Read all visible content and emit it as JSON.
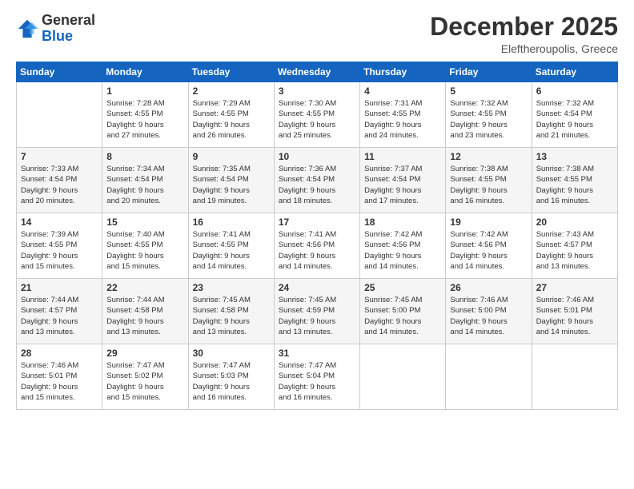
{
  "logo": {
    "general": "General",
    "blue": "Blue"
  },
  "header": {
    "month": "December 2025",
    "location": "Eleftheroupolis, Greece"
  },
  "weekdays": [
    "Sunday",
    "Monday",
    "Tuesday",
    "Wednesday",
    "Thursday",
    "Friday",
    "Saturday"
  ],
  "weeks": [
    [
      {
        "day": "",
        "info": ""
      },
      {
        "day": "1",
        "info": "Sunrise: 7:28 AM\nSunset: 4:55 PM\nDaylight: 9 hours\nand 27 minutes."
      },
      {
        "day": "2",
        "info": "Sunrise: 7:29 AM\nSunset: 4:55 PM\nDaylight: 9 hours\nand 26 minutes."
      },
      {
        "day": "3",
        "info": "Sunrise: 7:30 AM\nSunset: 4:55 PM\nDaylight: 9 hours\nand 25 minutes."
      },
      {
        "day": "4",
        "info": "Sunrise: 7:31 AM\nSunset: 4:55 PM\nDaylight: 9 hours\nand 24 minutes."
      },
      {
        "day": "5",
        "info": "Sunrise: 7:32 AM\nSunset: 4:55 PM\nDaylight: 9 hours\nand 23 minutes."
      },
      {
        "day": "6",
        "info": "Sunrise: 7:32 AM\nSunset: 4:54 PM\nDaylight: 9 hours\nand 21 minutes."
      }
    ],
    [
      {
        "day": "7",
        "info": "Sunrise: 7:33 AM\nSunset: 4:54 PM\nDaylight: 9 hours\nand 20 minutes."
      },
      {
        "day": "8",
        "info": "Sunrise: 7:34 AM\nSunset: 4:54 PM\nDaylight: 9 hours\nand 20 minutes."
      },
      {
        "day": "9",
        "info": "Sunrise: 7:35 AM\nSunset: 4:54 PM\nDaylight: 9 hours\nand 19 minutes."
      },
      {
        "day": "10",
        "info": "Sunrise: 7:36 AM\nSunset: 4:54 PM\nDaylight: 9 hours\nand 18 minutes."
      },
      {
        "day": "11",
        "info": "Sunrise: 7:37 AM\nSunset: 4:54 PM\nDaylight: 9 hours\nand 17 minutes."
      },
      {
        "day": "12",
        "info": "Sunrise: 7:38 AM\nSunset: 4:55 PM\nDaylight: 9 hours\nand 16 minutes."
      },
      {
        "day": "13",
        "info": "Sunrise: 7:38 AM\nSunset: 4:55 PM\nDaylight: 9 hours\nand 16 minutes."
      }
    ],
    [
      {
        "day": "14",
        "info": "Sunrise: 7:39 AM\nSunset: 4:55 PM\nDaylight: 9 hours\nand 15 minutes."
      },
      {
        "day": "15",
        "info": "Sunrise: 7:40 AM\nSunset: 4:55 PM\nDaylight: 9 hours\nand 15 minutes."
      },
      {
        "day": "16",
        "info": "Sunrise: 7:41 AM\nSunset: 4:55 PM\nDaylight: 9 hours\nand 14 minutes."
      },
      {
        "day": "17",
        "info": "Sunrise: 7:41 AM\nSunset: 4:56 PM\nDaylight: 9 hours\nand 14 minutes."
      },
      {
        "day": "18",
        "info": "Sunrise: 7:42 AM\nSunset: 4:56 PM\nDaylight: 9 hours\nand 14 minutes."
      },
      {
        "day": "19",
        "info": "Sunrise: 7:42 AM\nSunset: 4:56 PM\nDaylight: 9 hours\nand 14 minutes."
      },
      {
        "day": "20",
        "info": "Sunrise: 7:43 AM\nSunset: 4:57 PM\nDaylight: 9 hours\nand 13 minutes."
      }
    ],
    [
      {
        "day": "21",
        "info": "Sunrise: 7:44 AM\nSunset: 4:57 PM\nDaylight: 9 hours\nand 13 minutes."
      },
      {
        "day": "22",
        "info": "Sunrise: 7:44 AM\nSunset: 4:58 PM\nDaylight: 9 hours\nand 13 minutes."
      },
      {
        "day": "23",
        "info": "Sunrise: 7:45 AM\nSunset: 4:58 PM\nDaylight: 9 hours\nand 13 minutes."
      },
      {
        "day": "24",
        "info": "Sunrise: 7:45 AM\nSunset: 4:59 PM\nDaylight: 9 hours\nand 13 minutes."
      },
      {
        "day": "25",
        "info": "Sunrise: 7:45 AM\nSunset: 5:00 PM\nDaylight: 9 hours\nand 14 minutes."
      },
      {
        "day": "26",
        "info": "Sunrise: 7:46 AM\nSunset: 5:00 PM\nDaylight: 9 hours\nand 14 minutes."
      },
      {
        "day": "27",
        "info": "Sunrise: 7:46 AM\nSunset: 5:01 PM\nDaylight: 9 hours\nand 14 minutes."
      }
    ],
    [
      {
        "day": "28",
        "info": "Sunrise: 7:46 AM\nSunset: 5:01 PM\nDaylight: 9 hours\nand 15 minutes."
      },
      {
        "day": "29",
        "info": "Sunrise: 7:47 AM\nSunset: 5:02 PM\nDaylight: 9 hours\nand 15 minutes."
      },
      {
        "day": "30",
        "info": "Sunrise: 7:47 AM\nSunset: 5:03 PM\nDaylight: 9 hours\nand 16 minutes."
      },
      {
        "day": "31",
        "info": "Sunrise: 7:47 AM\nSunset: 5:04 PM\nDaylight: 9 hours\nand 16 minutes."
      },
      {
        "day": "",
        "info": ""
      },
      {
        "day": "",
        "info": ""
      },
      {
        "day": "",
        "info": ""
      }
    ]
  ]
}
